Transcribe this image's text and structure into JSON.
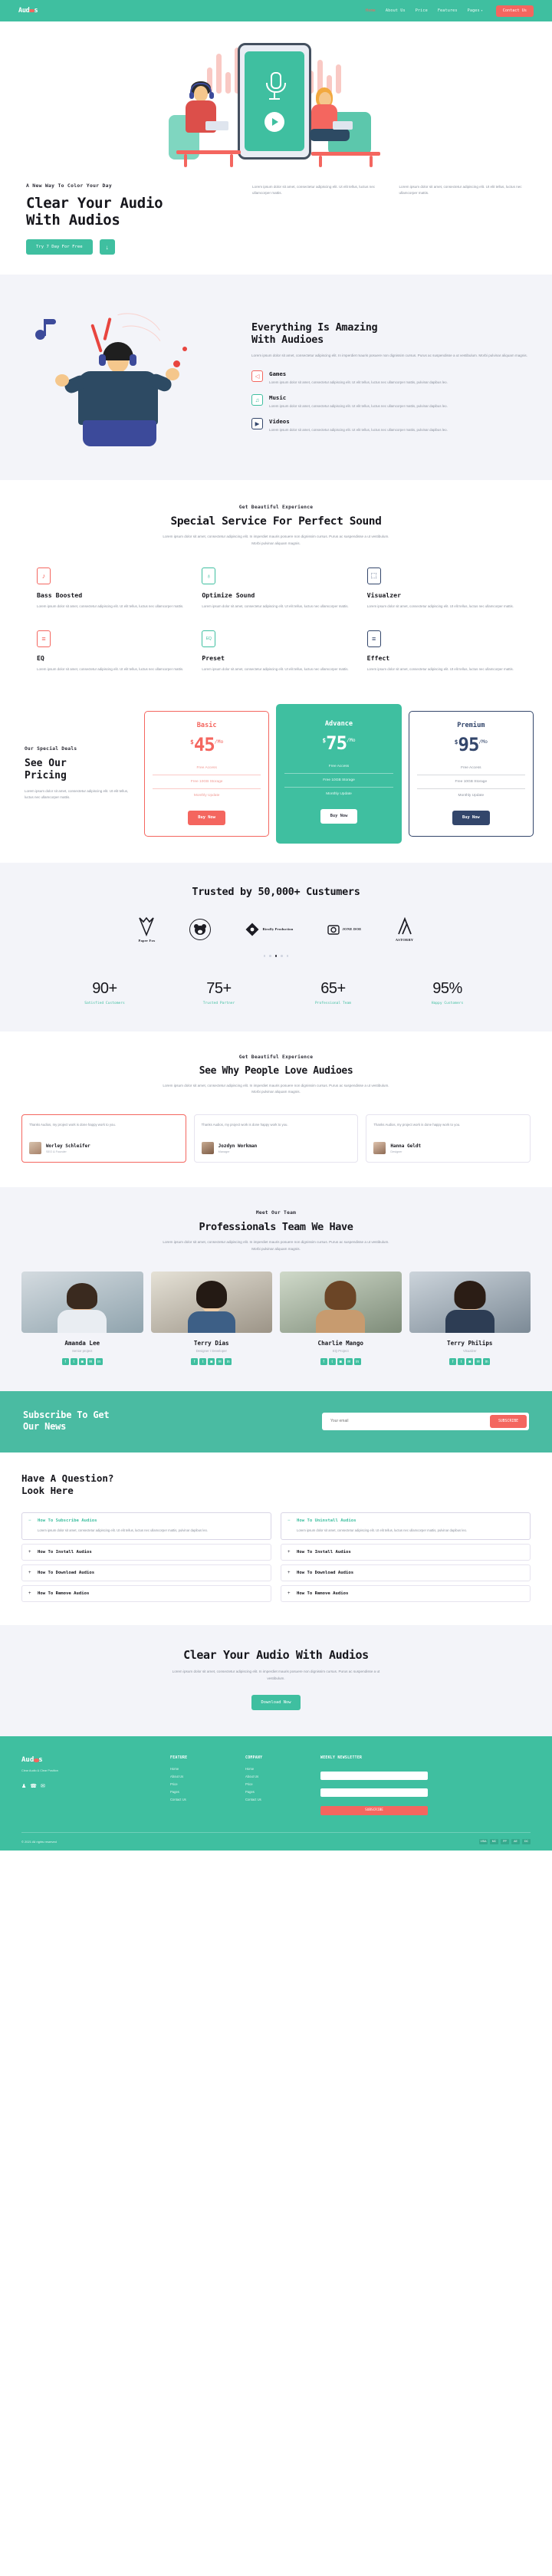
{
  "brand": {
    "name_a": "Aud",
    "name_b": "s",
    "accent": "#f4665f",
    "primary": "#3fbfa0",
    "navy": "#33466b"
  },
  "nav": {
    "items": [
      {
        "label": "Home",
        "active": true
      },
      {
        "label": "About Us",
        "active": false
      },
      {
        "label": "Price",
        "active": false
      },
      {
        "label": "Features",
        "active": false
      },
      {
        "label": "Pages",
        "active": false,
        "caret": "▾"
      }
    ],
    "cta": "Contact Us"
  },
  "hero": {
    "eyebrow": "A New Way To Color Your Day",
    "title_line1": "Clear Your Audio",
    "title_line2": "With Audios",
    "para_left": "Lorem ipsum dolor sit amet, consectetur adipiscing elit. Ut elit tellus, luctus nec ullamcorper mattis.",
    "para_right": "Lorem ipsum dolor sit amet, consectetur adipiscing elit. Ut elit tellus, luctus nec ullamcorper mattis.",
    "btn_primary": "Try 7 Day For Free",
    "btn_icon": "↓"
  },
  "amazing": {
    "title_line1": "Everything Is Amazing",
    "title_line2": "With Audioes",
    "para": "Lorem ipsum dolor sit amet, consectetur adipiscing elit. In imperdiet mauris posuere non dignissim cursus. Purus ac suspendisse a ut vestibulum. Morbi pulvinar aliquam magnis.",
    "features": [
      {
        "icon": "headphones-icon",
        "glyph": "◁",
        "title": "Games",
        "body": "Lorem ipsum dolor sit amet, consectetur adipiscing elit. Ut elit tellus, luctus nec ullamcorper mattis, pulvinar dapibus leo.",
        "tone": "red"
      },
      {
        "icon": "music-note-icon",
        "glyph": "♫",
        "title": "Music",
        "body": "Lorem ipsum dolor sit amet, consectetur adipiscing elit. Ut elit tellus, luctus nec ullamcorper mattis, pulvinar dapibus leo.",
        "tone": "teal"
      },
      {
        "icon": "video-camera-icon",
        "glyph": "▶",
        "title": "Videos",
        "body": "Lorem ipsum dolor sit amet, consectetur adipiscing elit. Ut elit tellus, luctus nec ullamcorper mattis, pulvinar dapibus leo.",
        "tone": "navy"
      }
    ]
  },
  "service": {
    "eyebrow": "Get Beautiful Experience",
    "title": "Special Service For Perfect Sound",
    "sub": "Lorem ipsum dolor sit amet, consectetur adipiscing elit. In imperdiet mauris posuere non dignissim cursus. Purus ac suspendisse a ut vestibulum. Morbi pulvinar aliquam magnis.",
    "items": [
      {
        "icon": "bass-note-icon",
        "glyph": "♪",
        "title": "Bass Boosted",
        "body": "Lorem ipsum dolor sit amet, consectetur adipiscing elit. Ut elit tellus, luctus nec ullamcorper mattis.",
        "tone": "red"
      },
      {
        "icon": "tuning-fork-icon",
        "glyph": "♁",
        "title": "Optimize Sound",
        "body": "Lorem ipsum dolor sit amet, consectetur adipiscing elit. Ut elit tellus, luctus nec ullamcorper mattis.",
        "tone": "teal"
      },
      {
        "icon": "device-icon",
        "glyph": "⬚",
        "title": "Visualzer",
        "body": "Lorem ipsum dolor sit amet, consectetur adipiscing elit. Ut elit tellus, luctus nec ullamcorper mattis.",
        "tone": "navy"
      },
      {
        "icon": "sliders-icon",
        "glyph": "≡",
        "title": "EQ",
        "body": "Lorem ipsum dolor sit amet, consectetur adipiscing elit. Ut elit tellus, luctus nec ullamcorper mattis.",
        "tone": "red"
      },
      {
        "icon": "preset-icon",
        "glyph": "EQ",
        "title": "Preset",
        "body": "Lorem ipsum dolor sit amet, consectetur adipiscing elit. Ut elit tellus, luctus nec ullamcorper mattis.",
        "tone": "teal"
      },
      {
        "icon": "effect-sliders-icon",
        "glyph": "≡",
        "title": "Effect",
        "body": "Lorem ipsum dolor sit amet, consectetur adipiscing elit. Ut elit tellus, luctus nec ullamcorper mattis.",
        "tone": "navy"
      }
    ]
  },
  "pricing": {
    "eyebrow": "Our Special Deals",
    "title_line1": "See Our",
    "title_line2": "Pricing",
    "para": "Lorem ipsum dolor sit amet, consectetur adipiscing elit. Ut elit tellus, luctus nec ullamcorper mattis.",
    "plans": [
      {
        "name": "Basic",
        "currency": "$",
        "amount": "45",
        "period": "/Mo",
        "features": [
          "Free Access",
          "Free 10GB Storage",
          "Monthly Update"
        ],
        "cta": "Buy Now",
        "featured": false
      },
      {
        "name": "Advance",
        "currency": "$",
        "amount": "75",
        "period": "/Mo",
        "features": [
          "Free Access",
          "Free 10GB Storage",
          "Monthly Update"
        ],
        "cta": "Buy Now",
        "featured": true
      },
      {
        "name": "Premium",
        "currency": "$",
        "amount": "95",
        "period": "/Mo",
        "features": [
          "Free Access",
          "Free 10GB Storage",
          "Monthly Update"
        ],
        "cta": "Buy Now",
        "featured": false
      }
    ]
  },
  "trusted": {
    "title": "Trusted by 50,000+ Custumers",
    "logos": [
      {
        "name": "paper-fox-logo",
        "caption": "Paper Fox"
      },
      {
        "name": "teddy-bear-logo",
        "caption": "TEDDY BEAR"
      },
      {
        "name": "birolly-production-logo",
        "caption": "Birolly Production"
      },
      {
        "name": "jone-doe-logo",
        "caption": "JONE DOE"
      },
      {
        "name": "astorry-logo",
        "caption": "ASTORRY"
      }
    ],
    "carousel_dots": 5,
    "active_dot": 2,
    "stats": [
      {
        "value": "90+",
        "label": "Satisfied Customers"
      },
      {
        "value": "75+",
        "label": "Trusted Partner"
      },
      {
        "value": "65+",
        "label": "Professional Team"
      },
      {
        "value": "95%",
        "label": "Happy Customers"
      }
    ]
  },
  "testimonials": {
    "eyebrow": "Get Beautiful Experience",
    "title": "See Why People Love Audioes",
    "sub": "Lorem ipsum dolor sit amet, consectetur adipiscing elit. In imperdiet mauris posuere non dignissim cursus. Purus ac suspendisse a ut vestibulum. Morbi pulvinar aliquam magnis.",
    "cards": [
      {
        "quote": "Thanks Audios, my project work is done happy work to you.",
        "name": "Worley Schleifer",
        "role": "SEO & Founder",
        "highlight": true
      },
      {
        "quote": "Thanks Audios, my project work is done happy work to you.",
        "name": "Jozdyn Workman",
        "role": "Manager",
        "highlight": false
      },
      {
        "quote": "Thanks Audios, my project work is done happy work to you.",
        "name": "Hanna Geldt",
        "role": "Designer",
        "highlight": false
      }
    ]
  },
  "team": {
    "eyebrow": "Meet Our Team",
    "title": "Professionals Team We Have",
    "sub": "Lorem ipsum dolor sit amet, consectetur adipiscing elit. In imperdiet mauris posuere non dignissim cursus. Purus ac suspendisse a ut vestibulum. Morbi pulvinar aliquam magnis.",
    "members": [
      {
        "name": "Amanda Lee",
        "role": "Senior project",
        "socials": [
          "f",
          "t",
          "i",
          "m",
          "in"
        ]
      },
      {
        "name": "Terry Dias",
        "role": "Designer / Developer",
        "socials": [
          "f",
          "t",
          "i",
          "m",
          "in"
        ]
      },
      {
        "name": "Charlie Mango",
        "role": "EQ Project",
        "socials": [
          "f",
          "t",
          "i",
          "m",
          "in"
        ]
      },
      {
        "name": "Terry Philips",
        "role": "Visualzer",
        "socials": [
          "f",
          "t",
          "i",
          "m",
          "in"
        ]
      }
    ]
  },
  "subscribe": {
    "title_line1": "Subscribe To Get",
    "title_line2": "Our News",
    "placeholder": "Your email",
    "button": "SUBSCRIBE"
  },
  "faq": {
    "title_line1": "Have A Question?",
    "title_line2": "Look Here",
    "left": {
      "open": {
        "sign": "−",
        "q": "How To Subscribe Audios",
        "a": "Lorem ipsum dolor sit amet, consectetur adipiscing elit. Ut elit tellus, luctus nec ullamcorper mattis, pulvinar dapibus leo."
      },
      "items": [
        {
          "sign": "+",
          "q": "How To Install Audios"
        },
        {
          "sign": "+",
          "q": "How To Download Audios"
        },
        {
          "sign": "+",
          "q": "How To Remove Audios"
        }
      ]
    },
    "right": {
      "open": {
        "sign": "−",
        "q": "How To Uninstall Audios",
        "a": "Lorem ipsum dolor sit amet, consectetur adipiscing elit. Ut elit tellus, luctus nec ullamcorper mattis, pulvinar dapibus leo."
      },
      "items": [
        {
          "sign": "+",
          "q": "How To Install Audios"
        },
        {
          "sign": "+",
          "q": "How To Download Audios"
        },
        {
          "sign": "+",
          "q": "How To Remove Audios"
        }
      ]
    }
  },
  "cta": {
    "title": "Clear Your Audio With Audios",
    "para": "Lorem ipsum dolor sit amet, consectetur adipiscing elit. In imperdiet mauris posuere non dignissim cursus. Purus ac suspendisse a ut vestibulum.",
    "button": "Download Now"
  },
  "footer": {
    "tagline": "Clear Audio & Clear Position",
    "social": [
      "👤",
      "☎",
      "✉"
    ],
    "columns": [
      {
        "heading": "FEATURE",
        "links": [
          "Home",
          "About Us",
          "Price",
          "Pages",
          "Contact Us"
        ]
      },
      {
        "heading": "COMPANY",
        "links": [
          "Home",
          "About Us",
          "Price",
          "Pages",
          "Contact Us"
        ]
      }
    ],
    "newsletter_heading": "WEEKLY NEWSLETTER",
    "newsletter_name_placeholder": "",
    "newsletter_email_placeholder": "",
    "newsletter_button": "SUBSCRIBE",
    "copyright": "© 2021 All rights reserved",
    "payments": [
      "VISA",
      "MC",
      "PP",
      "AE",
      "DC"
    ]
  }
}
